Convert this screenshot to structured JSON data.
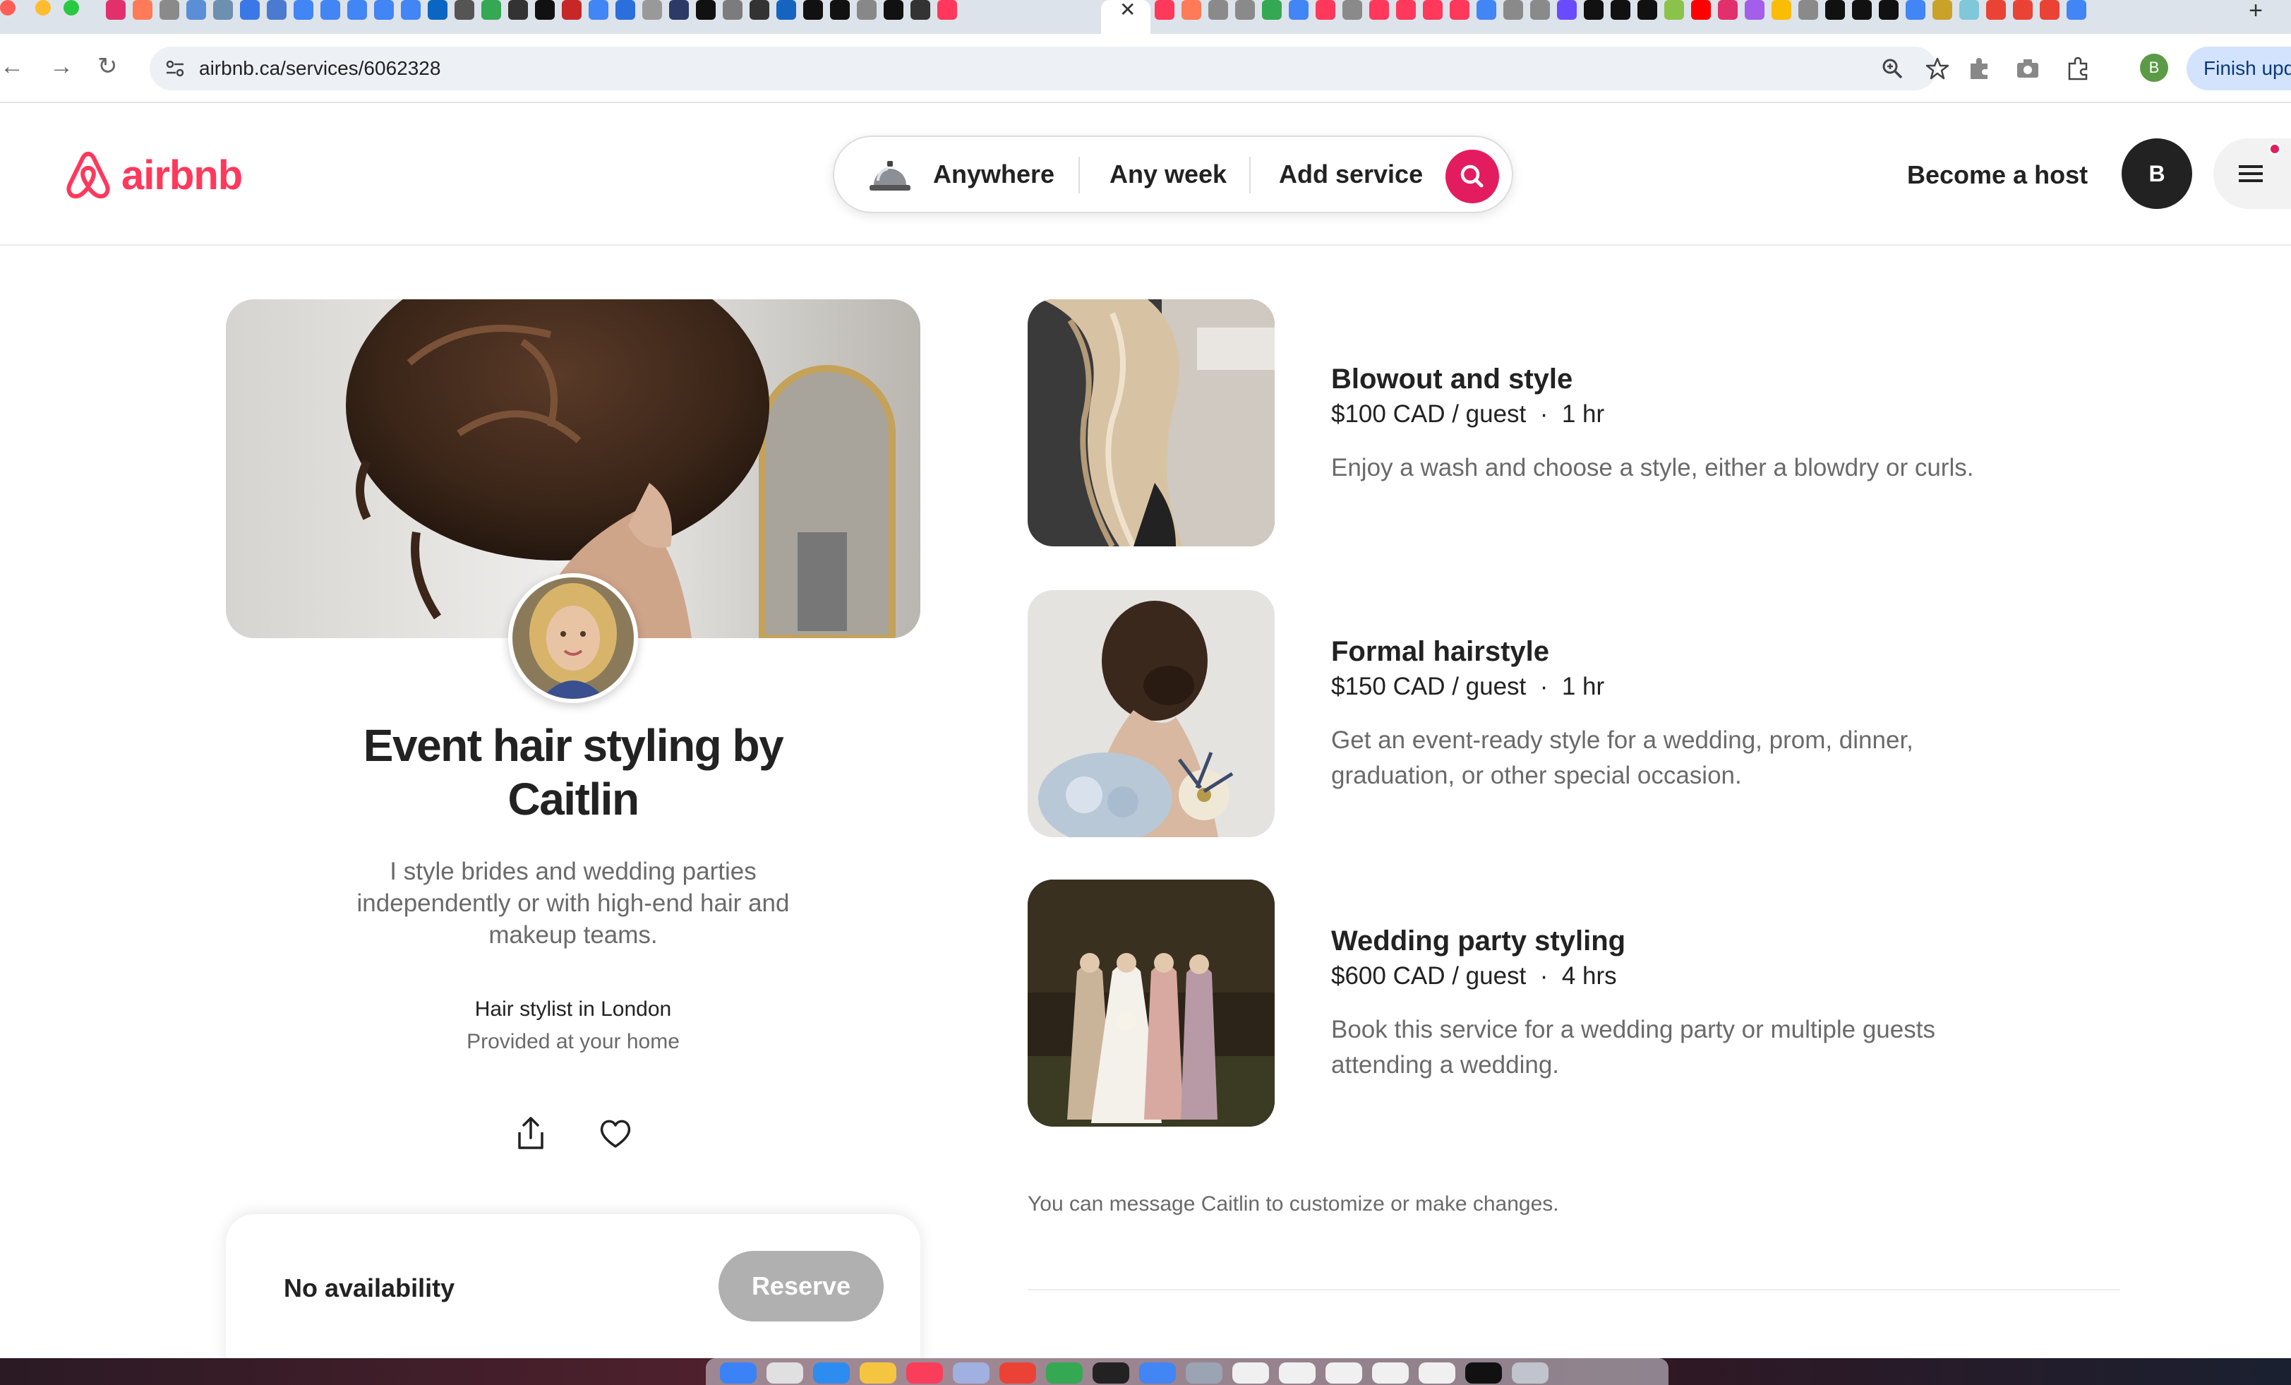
{
  "browser": {
    "url": "airbnb.ca/services/6062328",
    "finish_update_label": "Finish upd",
    "profile_initial": "B"
  },
  "header": {
    "logo_text": "airbnb",
    "search": {
      "where": "Anywhere",
      "when": "Any week",
      "what": "Add service"
    },
    "become_host": "Become a host",
    "avatar_initial": "B"
  },
  "service": {
    "title": "Event hair styling by Caitlin",
    "description": "I style brides and wedding parties independently or with high-end hair and makeup teams.",
    "category": "Hair stylist in London",
    "location_type": "Provided at your home"
  },
  "availability": {
    "status": "No availability",
    "reserve_label": "Reserve"
  },
  "offerings": [
    {
      "name": "Blowout and style",
      "price": "$100 CAD / guest",
      "duration": "1 hr",
      "description": "Enjoy a wash and choose a style, either a blowdry or curls."
    },
    {
      "name": "Formal hairstyle",
      "price": "$150 CAD / guest",
      "duration": "1 hr",
      "description": "Get an event-ready style for a wedding, prom, dinner, graduation, or other special occasion."
    },
    {
      "name": "Wedding party styling",
      "price": "$600 CAD / guest",
      "duration": "4 hrs",
      "description": "Book this service for a wedding party or multiple guests attending a wedding."
    }
  ],
  "message_note": "You can message Caitlin to customize or make changes.",
  "colors": {
    "brand": "#ff385c",
    "search_button": "#e31c5f",
    "reserve_disabled": "#b0b0b0"
  }
}
